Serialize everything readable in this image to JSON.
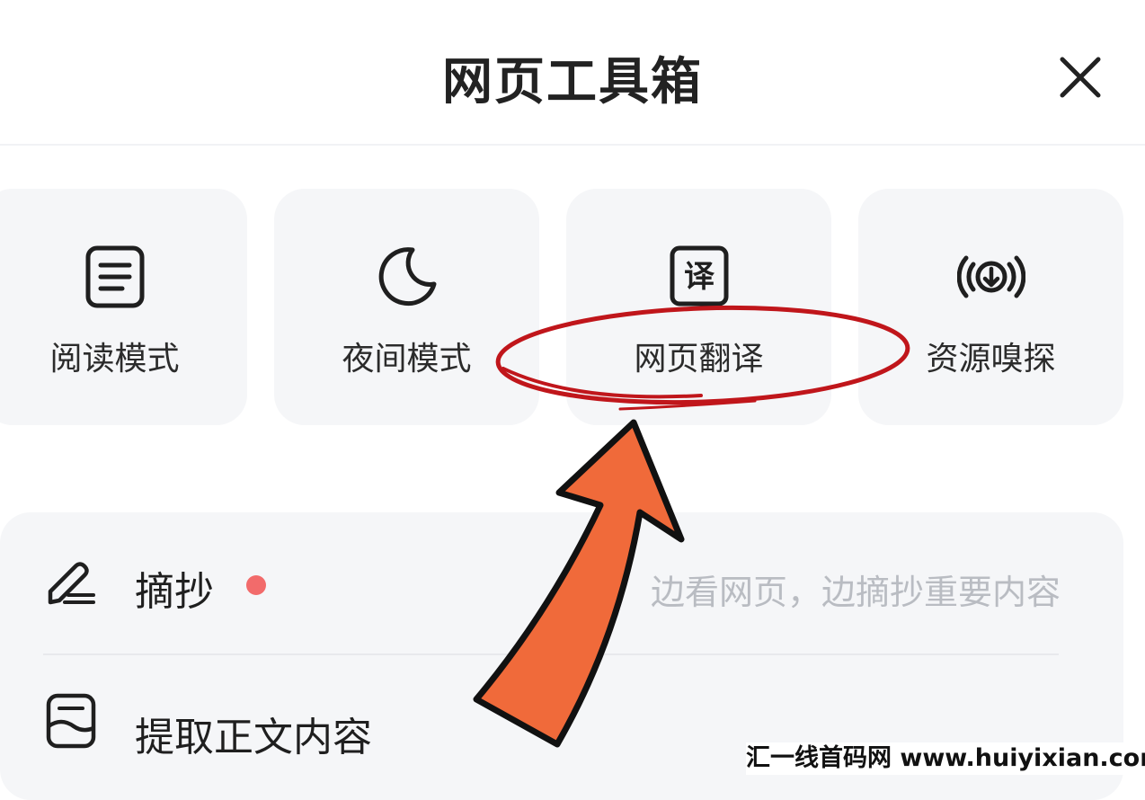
{
  "header": {
    "title": "网页工具箱"
  },
  "tools": [
    {
      "label": "阅读模式",
      "icon": "reader-mode-icon"
    },
    {
      "label": "夜间模式",
      "icon": "moon-icon"
    },
    {
      "label": "网页翻译",
      "icon": "translate-icon"
    },
    {
      "label": "资源嗅探",
      "icon": "sniff-icon"
    }
  ],
  "translate_icon_glyph": "译",
  "list": {
    "excerpt": {
      "label": "摘抄",
      "hint": "边看网页，边摘抄重要内容",
      "icon": "pen-icon",
      "badge_color": "#f26b6b"
    },
    "extract": {
      "label": "提取正文内容",
      "icon": "extract-text-icon"
    }
  },
  "annotation": {
    "circle_color": "#c0161b",
    "arrow_color": "#f06a3a"
  },
  "watermark": "汇一线首码网 www.huiyixian.com"
}
